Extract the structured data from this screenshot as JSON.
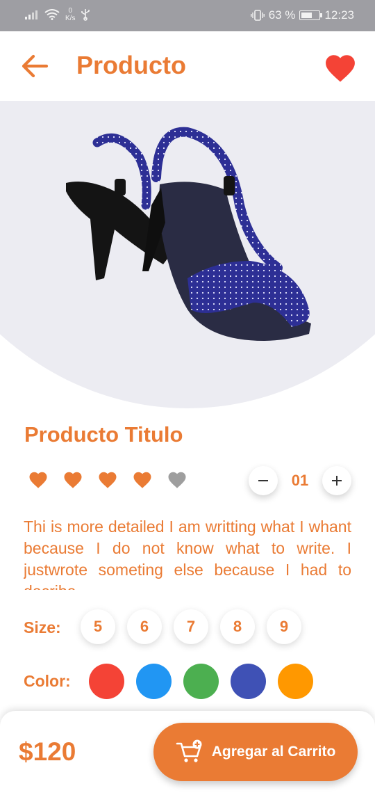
{
  "status_bar": {
    "net_speed_value": "0",
    "net_speed_unit": "K/s",
    "battery": "63 %",
    "time": "12:23"
  },
  "header": {
    "title": "Producto"
  },
  "product": {
    "title": "Producto Titulo",
    "rating": {
      "value": 4,
      "max": 5
    },
    "quantity": "01",
    "description": "Thi is more detailed I am writting what I whant because I do not know what to write. I justwrote someting else because I had to decribe",
    "size_label": "Size:",
    "sizes": [
      "5",
      "6",
      "7",
      "8",
      "9"
    ],
    "color_label": "Color:",
    "colors": [
      "#f44336",
      "#2196f3",
      "#4caf50",
      "#3f51b5",
      "#ff9800"
    ]
  },
  "footer": {
    "price": "$120",
    "cart_button_label": "Agregar al Carrito"
  },
  "theme": {
    "accent": "#ea7b34",
    "favorite": "#f44336",
    "rating_inactive": "#9e9e9e"
  },
  "icons": {
    "back": "arrow-left-icon",
    "favorite": "heart-icon",
    "rating": "heart-icon",
    "cart": "cart-plus-icon"
  }
}
